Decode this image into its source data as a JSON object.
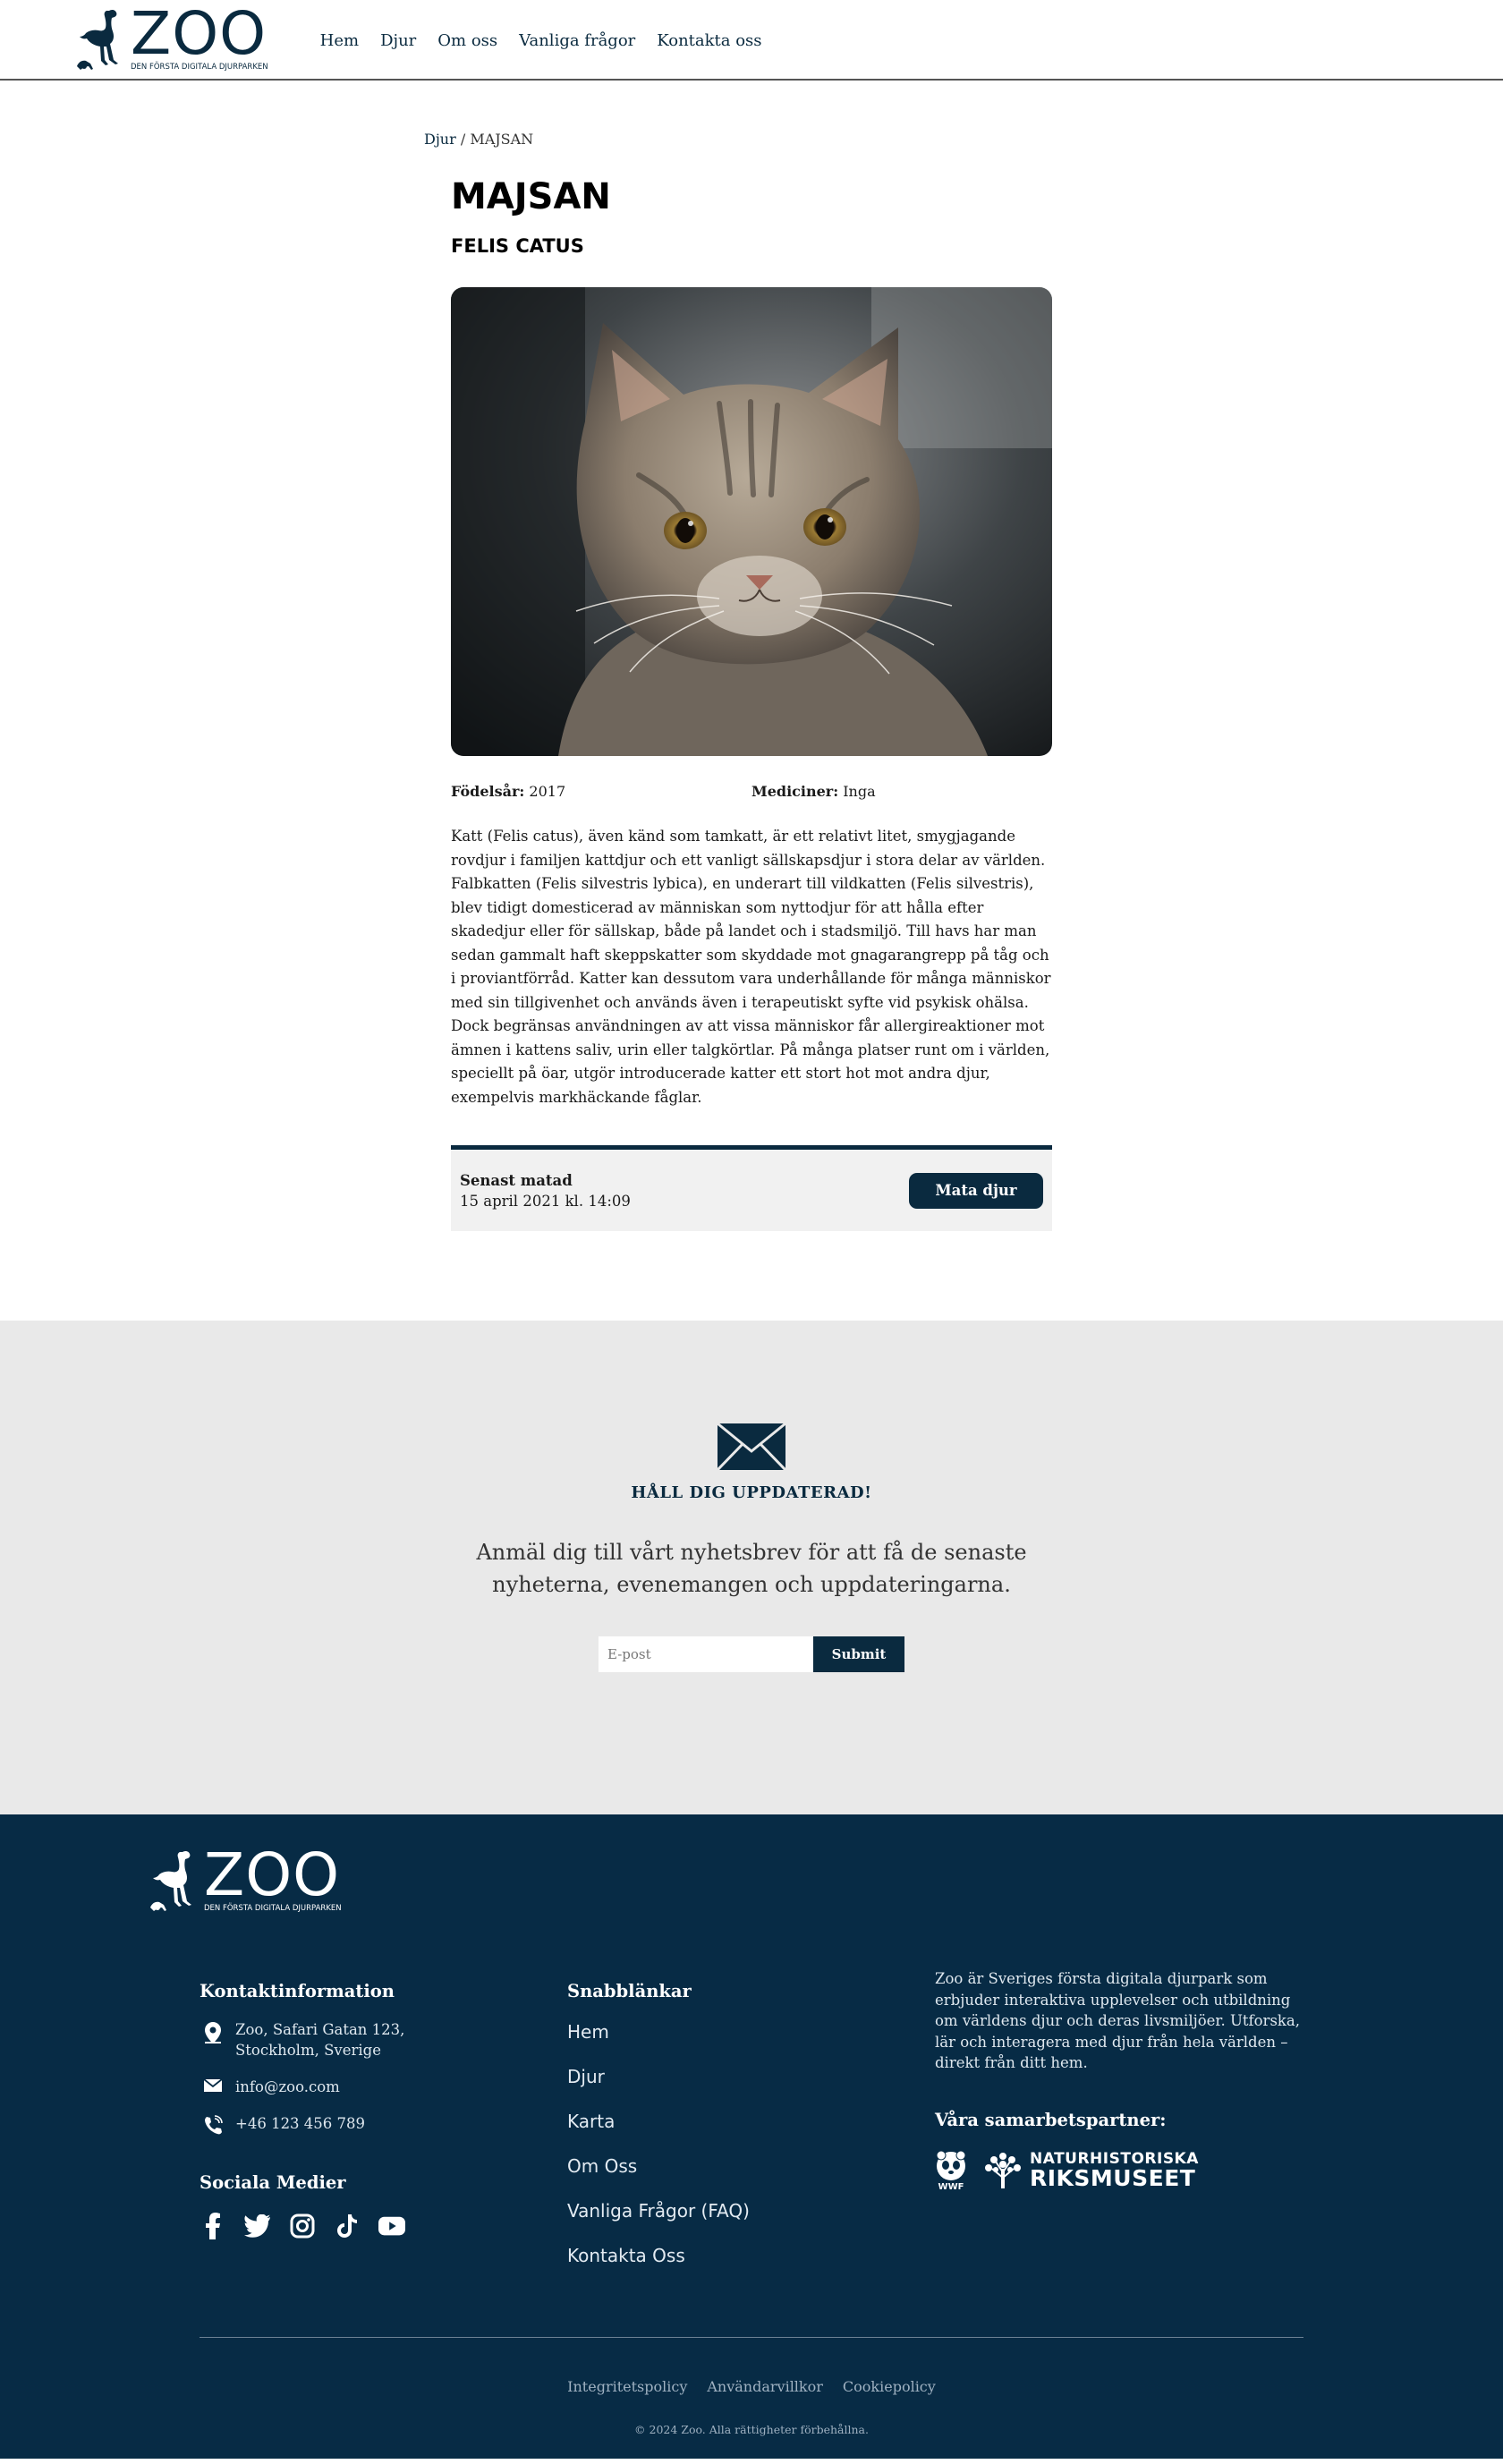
{
  "header": {
    "logo_text": "ZOO",
    "logo_tagline": "DEN FÖRSTA DIGITALA DJURPARKEN",
    "nav": [
      "Hem",
      "Djur",
      "Om oss",
      "Vanliga frågor",
      "Kontakta oss"
    ]
  },
  "breadcrumb": {
    "parent": "Djur",
    "separator": " / ",
    "current": "MAJSAN"
  },
  "animal": {
    "name": "MAJSAN",
    "species": "FELIS CATUS",
    "photo_icon": "cat-photo",
    "birth_label": "Födelsår:",
    "birth_value": "2017",
    "meds_label": "Mediciner:",
    "meds_value": "Inga",
    "description": "Katt (Felis catus), även känd som tamkatt, är ett relativt litet, smygjagande rovdjur i familjen kattdjur och ett vanligt sällskapsdjur i stora delar av världen. Falbkatten (Felis silvestris lybica), en underart till vildkatten (Felis silvestris), blev tidigt domesticerad av människan som nyttodjur för att hålla efter skadedjur eller för sällskap, både på landet och i stadsmiljö. Till havs har man sedan gammalt haft skeppskatter som skyddade mot gnagarangrepp på tåg och i proviantförråd. Katter kan dessutom vara underhållande för många människor med sin tillgivenhet och används även i terapeutiskt syfte vid psykisk ohälsa. Dock begränsas användningen av att vissa människor får allergireaktioner mot ämnen i kattens saliv, urin eller talgkörtlar. På många platser runt om i världen, speciellt på öar, utgör introducerade katter ett stort hot mot andra djur, exempelvis markhäckande fåglar."
  },
  "feeding": {
    "title": "Senast matad",
    "date": "15 april 2021 kl. 14:09",
    "button": "Mata djur"
  },
  "newsletter": {
    "icon": "envelope-icon",
    "title": "HÅLL DIG UPPDATERAD!",
    "text": "Anmäl dig till vårt nyhetsbrev för att få de senaste nyheterna, evenemangen och uppdateringarna.",
    "placeholder": "E-post",
    "submit": "Submit"
  },
  "footer": {
    "logo_text": "ZOO",
    "logo_tagline": "DEN FÖRSTA DIGITALA DJURPARKEN",
    "contact_title": "Kontaktinformation",
    "address_line1": "Zoo, Safari Gatan 123,",
    "address_line2": "Stockholm, Sverige",
    "email": "info@zoo.com",
    "phone": "+46 123 456 789",
    "social_title": "Sociala Medier",
    "social_icons": [
      "facebook-icon",
      "twitter-icon",
      "instagram-icon",
      "tiktok-icon",
      "youtube-icon"
    ],
    "quick_title": "Snabblänkar",
    "quick_links": [
      "Hem",
      "Djur",
      "Karta",
      "Om Oss",
      "Vanliga Frågor (FAQ)",
      "Kontakta Oss"
    ],
    "about": "Zoo är Sveriges första digitala djurpark som erbjuder interaktiva upplevelser och utbildning om världens djur och deras livsmiljöer. Utforska, lär och interagera med djur från hela världen – direkt från ditt hem.",
    "partners_title": "Våra samarbetspartner:",
    "partner_wwf": "WWF",
    "partner_nrm_line1": "NATURHISTORISKA",
    "partner_nrm_line2": "RIKSMUSEET",
    "legal_links": [
      "Integritetspolicy",
      "Användarvillkor",
      "Cookiepolicy"
    ],
    "copyright": "© 2024 Zoo. Alla rättigheter förbehållna."
  },
  "colors": {
    "brand_navy": "#0a2a3f",
    "footer_bg": "#072b45",
    "newsletter_bg": "#e9e9e9",
    "feed_box_bg": "#f1f1f1"
  }
}
